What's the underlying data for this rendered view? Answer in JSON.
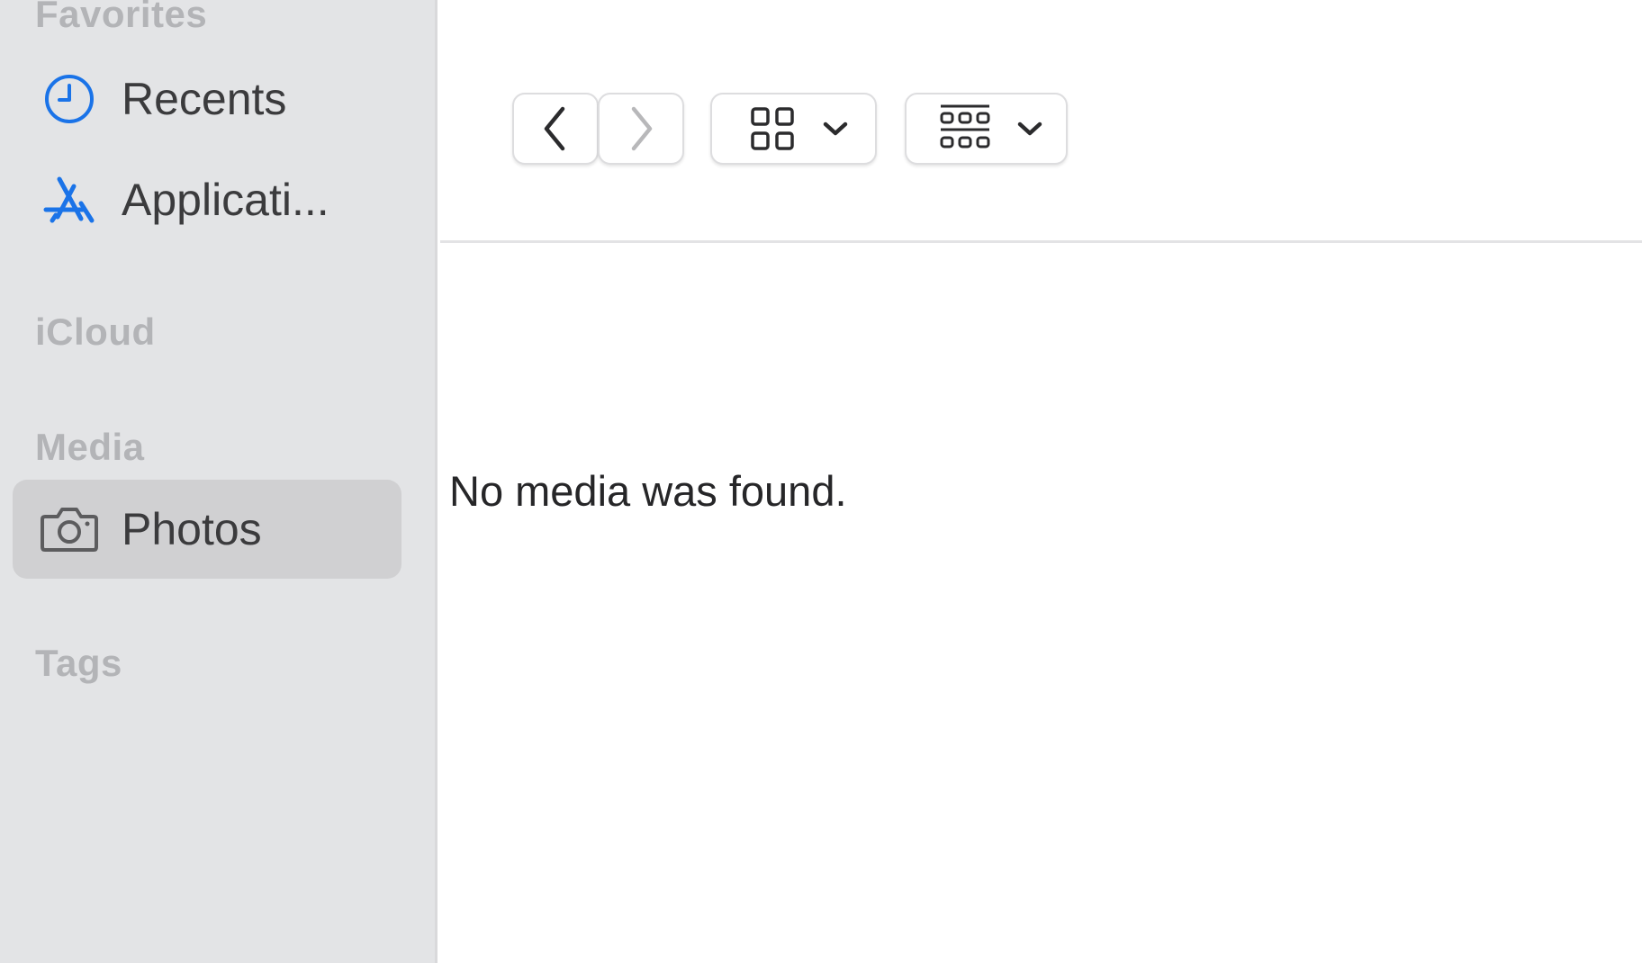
{
  "sidebar": {
    "sections": {
      "favorites": "Favorites",
      "icloud": "iCloud",
      "media": "Media",
      "tags": "Tags"
    },
    "items": [
      {
        "label": "Recents",
        "icon": "clock-icon",
        "selected": false
      },
      {
        "label": "Applicati...",
        "icon": "app-store-icon",
        "selected": false
      },
      {
        "label": "Photos",
        "icon": "camera-icon",
        "selected": true
      }
    ]
  },
  "toolbar": {
    "back": "chevron-left-icon",
    "forward": "chevron-right-icon",
    "view_mode": "grid-icon",
    "group_mode": "grid-rows-icon"
  },
  "main": {
    "empty_message": "No media was found."
  },
  "colors": {
    "accent": "#1a73e8",
    "sidebar_bg": "#e3e4e6",
    "selected_bg": "#d0d0d2"
  }
}
